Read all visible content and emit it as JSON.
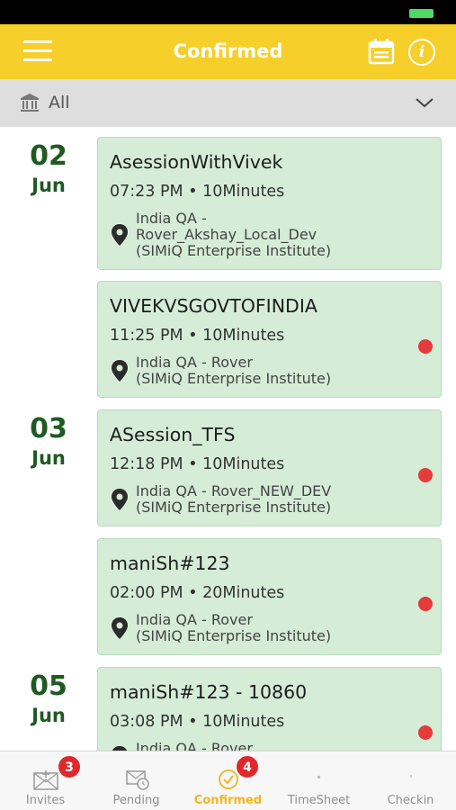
{
  "header": {
    "title": "Confirmed"
  },
  "filter": {
    "label": "All"
  },
  "groups": [
    {
      "day": "02",
      "month": "Jun"
    },
    {
      "day": "03",
      "month": "Jun"
    },
    {
      "day": "05",
      "month": "Jun"
    }
  ],
  "sessions": [
    {
      "title": "AsessionWithVivek",
      "time": "07:23 PM • 10Minutes",
      "location": "India QA -\nRover_Akshay_Local_Dev\n(SIMiQ Enterprise Institute)",
      "unread": false
    },
    {
      "title": "VIVEKVSGOVTOFINDIA",
      "time": "11:25 PM • 10Minutes",
      "location": "India QA - Rover\n(SIMiQ Enterprise Institute)",
      "unread": true
    },
    {
      "title": "ASession_TFS",
      "time": "12:18 PM • 10Minutes",
      "location": "India QA - Rover_NEW_DEV\n(SIMiQ Enterprise Institute)",
      "unread": true
    },
    {
      "title": "maniSh#123",
      "time": "02:00 PM • 20Minutes",
      "location": "India QA - Rover\n(SIMiQ Enterprise Institute)",
      "unread": true
    },
    {
      "title": "maniSh#123 - 10860",
      "time": "03:08 PM • 10Minutes",
      "location": "India QA - Rover",
      "unread": true
    }
  ],
  "tabs": [
    {
      "label": "Invites",
      "icon": "invite-envelope-icon",
      "badge": "3",
      "active": false
    },
    {
      "label": "Pending",
      "icon": "pending-envelope-clock-icon",
      "badge": "",
      "active": false
    },
    {
      "label": "Confirmed",
      "icon": "confirmed-check-circle-icon",
      "badge": "4",
      "active": true
    },
    {
      "label": "TimeSheet",
      "icon": "timesheet-icon",
      "badge": "",
      "active": false
    },
    {
      "label": "Checkin",
      "icon": "checkin-icon",
      "badge": "",
      "active": false
    }
  ],
  "colors": {
    "header": "#f6cf2a",
    "card": "#d5ecd7",
    "date": "#1f5a22",
    "accent": "#f3b621",
    "dot": "#e53b3b",
    "badge": "#e0282c"
  }
}
